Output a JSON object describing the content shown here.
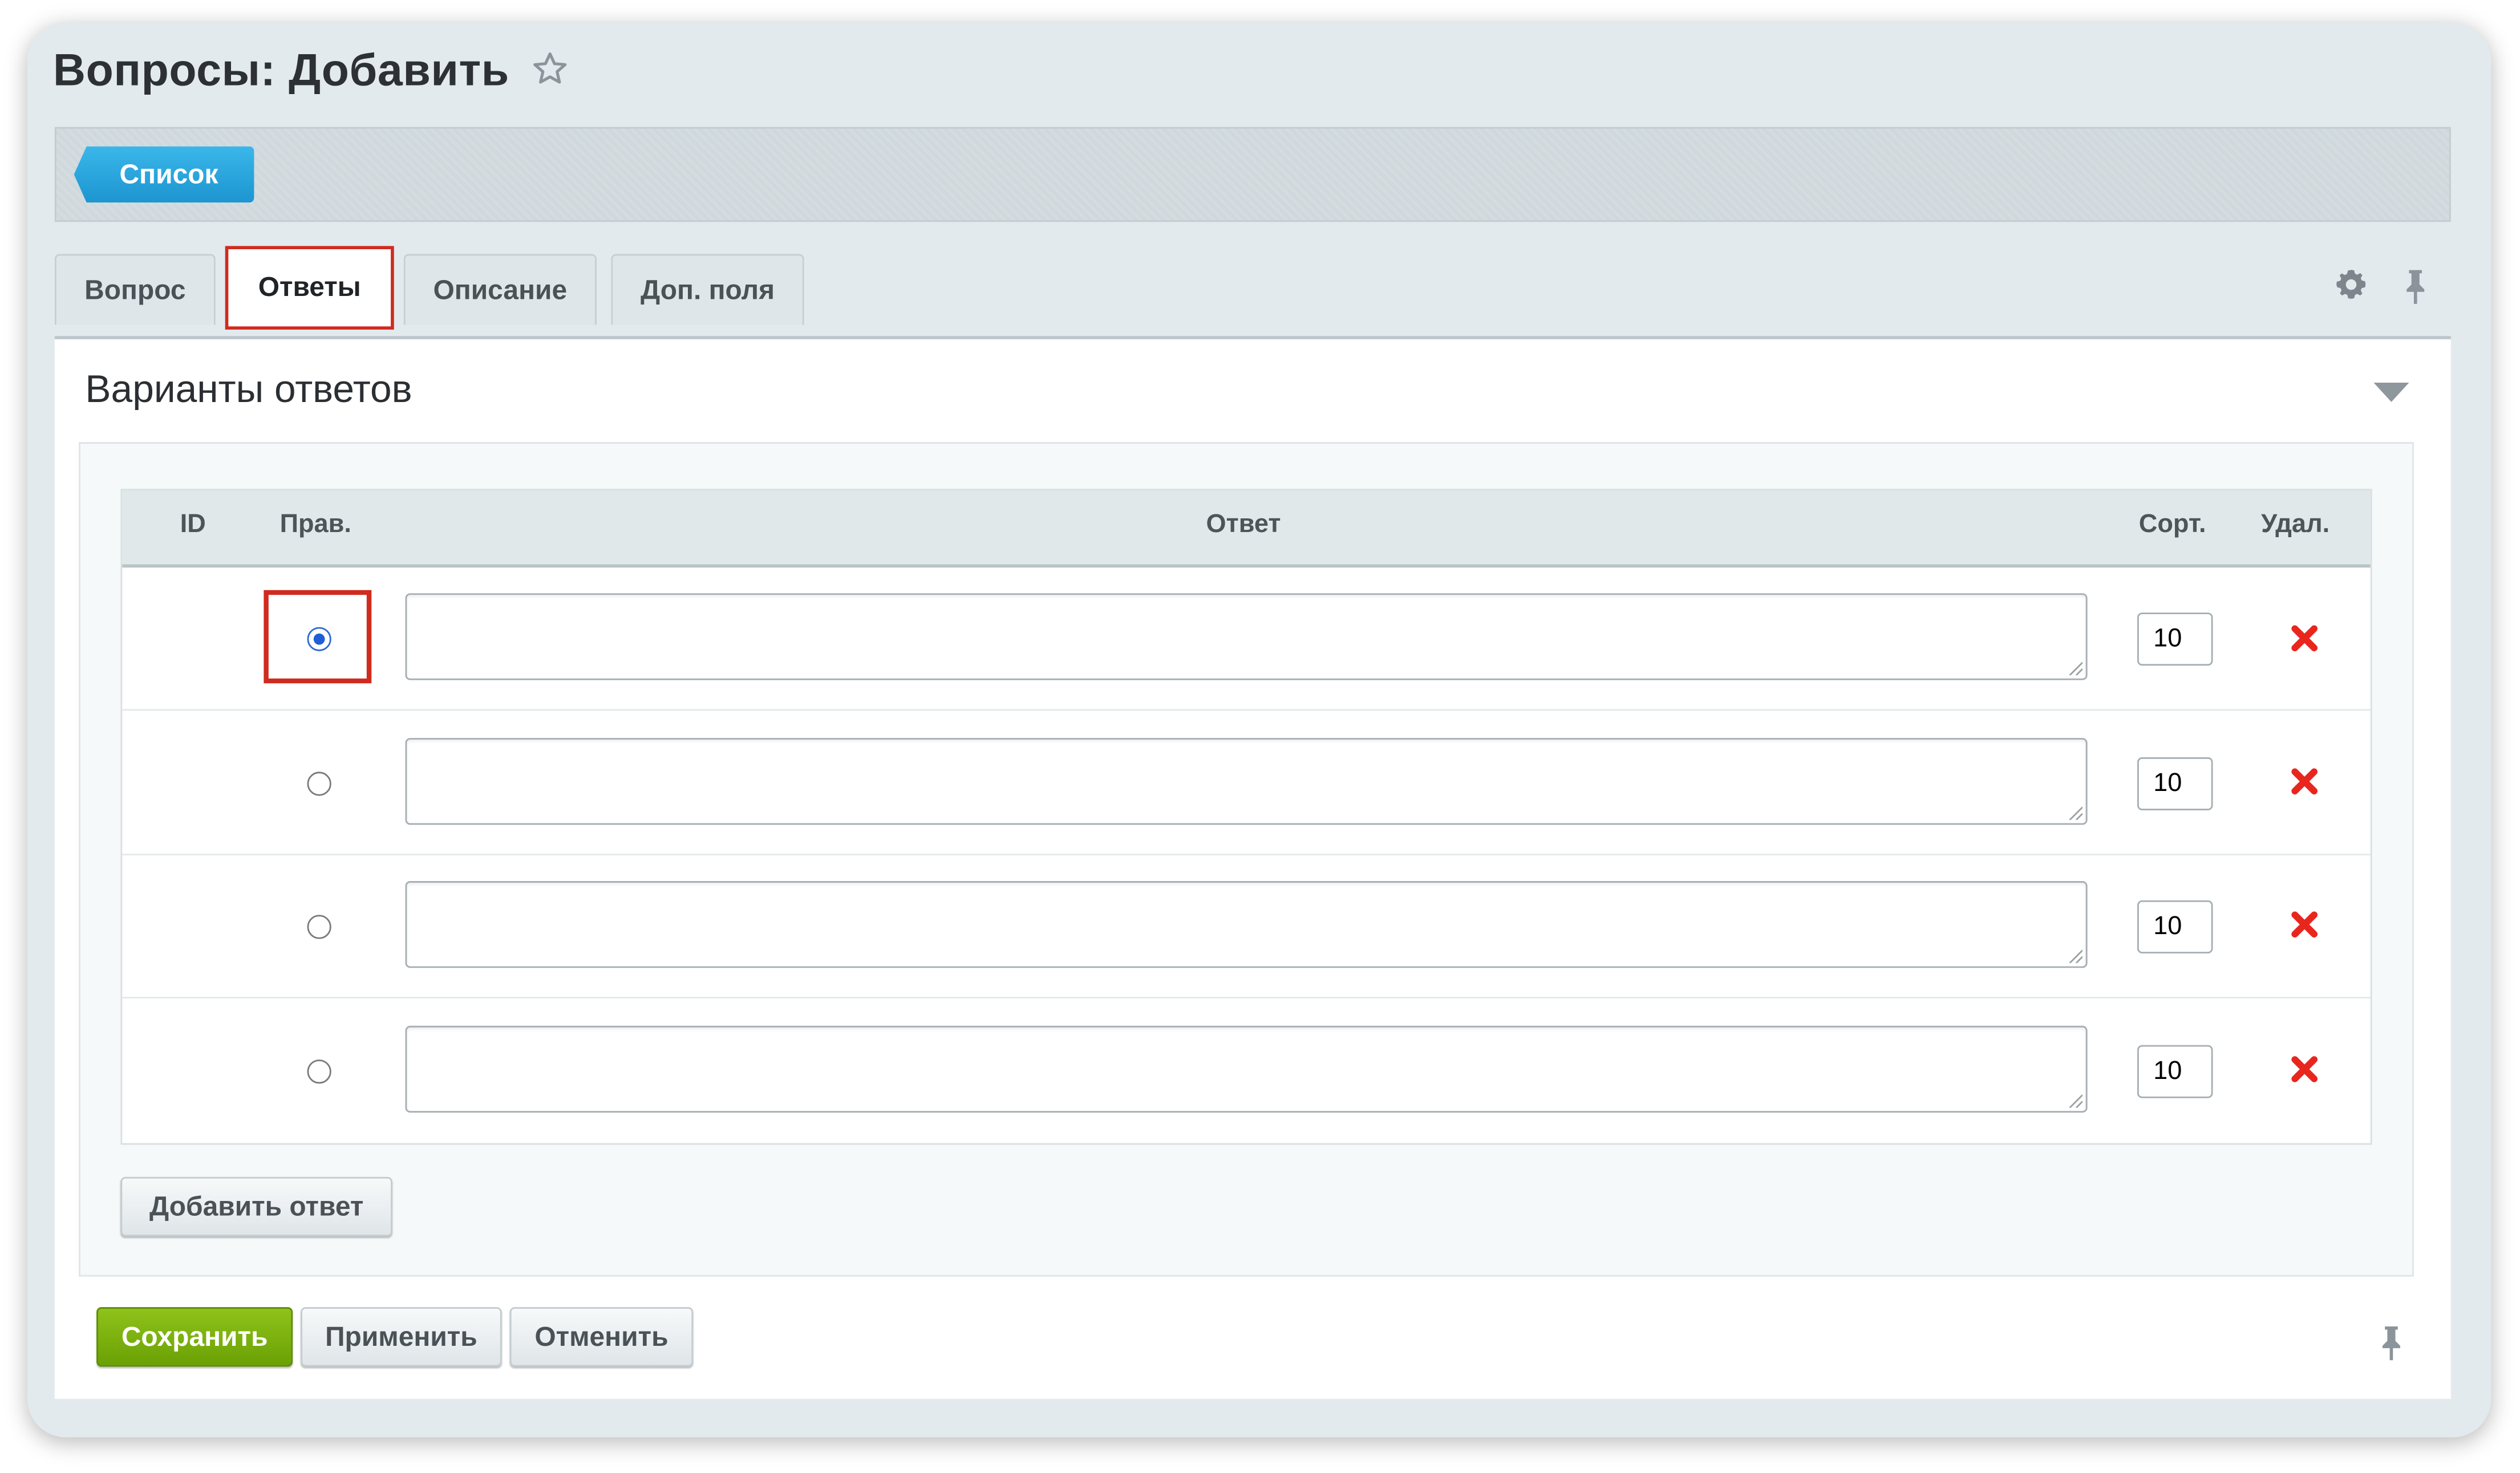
{
  "page": {
    "title": "Вопросы: Добавить"
  },
  "toolbar": {
    "list_button": "Список"
  },
  "tabs": [
    {
      "label": "Вопрос",
      "active": false
    },
    {
      "label": "Ответы",
      "active": true
    },
    {
      "label": "Описание",
      "active": false
    },
    {
      "label": "Доп. поля",
      "active": false
    }
  ],
  "section": {
    "title": "Варианты ответов"
  },
  "table": {
    "headers": {
      "id": "ID",
      "correct": "Прав.",
      "answer": "Ответ",
      "sort": "Сорт.",
      "delete": "Удал."
    },
    "rows": [
      {
        "id": "",
        "correct": true,
        "answer": "",
        "sort": "10"
      },
      {
        "id": "",
        "correct": false,
        "answer": "",
        "sort": "10"
      },
      {
        "id": "",
        "correct": false,
        "answer": "",
        "sort": "10"
      },
      {
        "id": "",
        "correct": false,
        "answer": "",
        "sort": "10"
      }
    ]
  },
  "actions": {
    "add_answer": "Добавить ответ",
    "save": "Сохранить",
    "apply": "Применить",
    "cancel": "Отменить"
  },
  "icons": [
    "star-icon",
    "gear-icon",
    "pin-icon",
    "chevron-down-icon",
    "delete-icon"
  ],
  "colors": {
    "accent_blue": "#1d95d0",
    "save_green": "#6aa104",
    "delete_red": "#e8261e",
    "highlight_red": "#d02b1f"
  }
}
